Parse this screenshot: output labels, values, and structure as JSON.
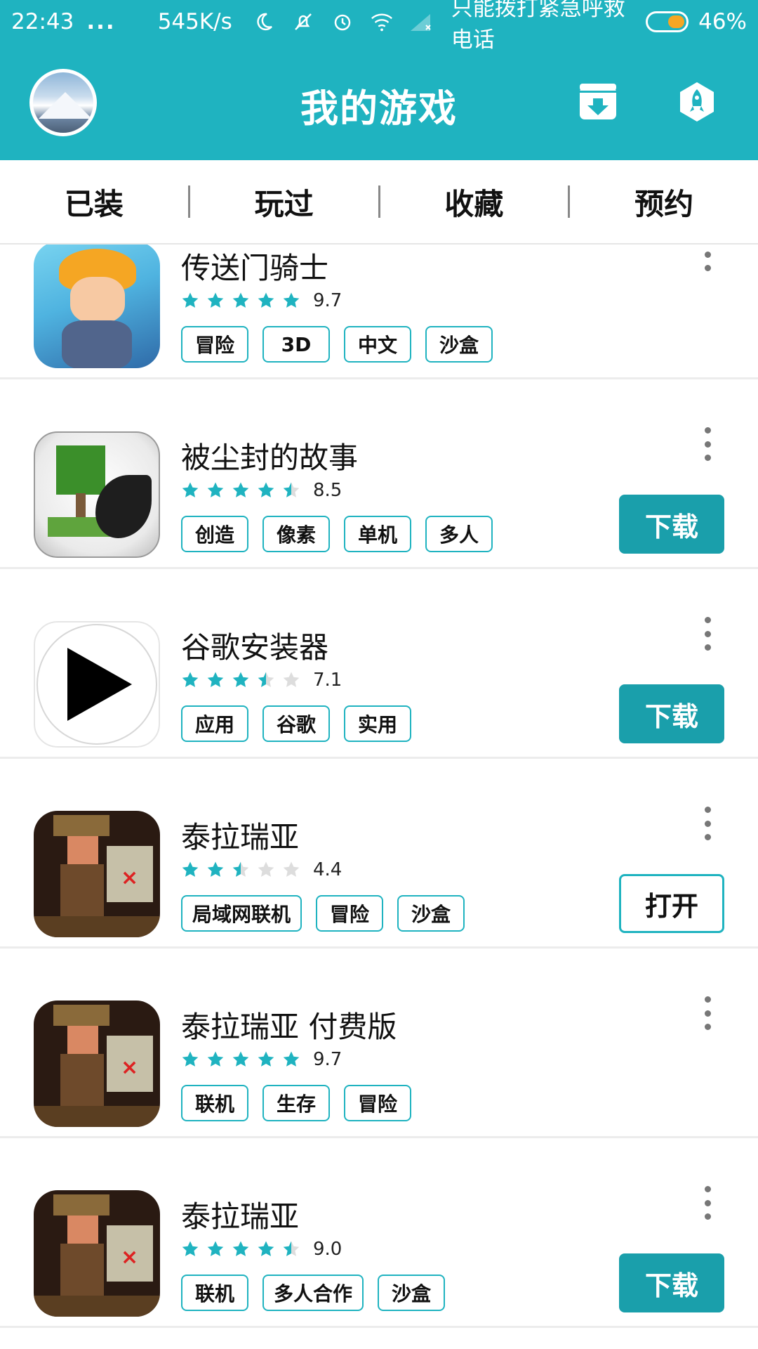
{
  "status_bar": {
    "time": "22:43",
    "dots": "...",
    "speed": "545K/s",
    "carrier": "只能拨打紧急呼救电话",
    "battery": "46%",
    "battery_level": 0.46,
    "icons": [
      "moon-icon",
      "mute-icon",
      "alarm-icon",
      "wifi-icon",
      "signal-icon"
    ]
  },
  "app_bar": {
    "title": "我的游戏",
    "left_icon": "avatar",
    "right_icons": [
      "download-box-icon",
      "rocket-icon"
    ]
  },
  "tabs": [
    {
      "label": "已装"
    },
    {
      "label": "玩过"
    },
    {
      "label": "收藏"
    },
    {
      "label": "预约"
    }
  ],
  "colors": {
    "accent": "#1fb3c0",
    "button": "#1a9fab",
    "star_off": "#dddddd"
  },
  "games": [
    {
      "name": "传送门骑士",
      "rating": 9.7,
      "rating_text": "9.7",
      "stars": 5,
      "tags": [
        "冒险",
        "3D",
        "中文",
        "沙盒"
      ],
      "action": ""
    },
    {
      "name": "被尘封的故事",
      "rating": 8.5,
      "rating_text": "8.5",
      "stars": 4.5,
      "tags": [
        "创造",
        "像素",
        "单机",
        "多人"
      ],
      "action": "下载"
    },
    {
      "name": "谷歌安装器",
      "rating": 7.1,
      "rating_text": "7.1",
      "stars": 3.5,
      "tags": [
        "应用",
        "谷歌",
        "实用"
      ],
      "action": "下载"
    },
    {
      "name": "泰拉瑞亚",
      "rating": 4.4,
      "rating_text": "4.4",
      "stars": 2.5,
      "tags": [
        "局域网联机",
        "冒险",
        "沙盒"
      ],
      "action": "打开"
    },
    {
      "name": "泰拉瑞亚 付费版",
      "rating": 9.7,
      "rating_text": "9.7",
      "stars": 5,
      "tags": [
        "联机",
        "生存",
        "冒险"
      ],
      "action": ""
    },
    {
      "name": "泰拉瑞亚",
      "rating": 9.0,
      "rating_text": "9.0",
      "stars": 4.5,
      "tags": [
        "联机",
        "多人合作",
        "沙盒"
      ],
      "action": "下载"
    }
  ]
}
